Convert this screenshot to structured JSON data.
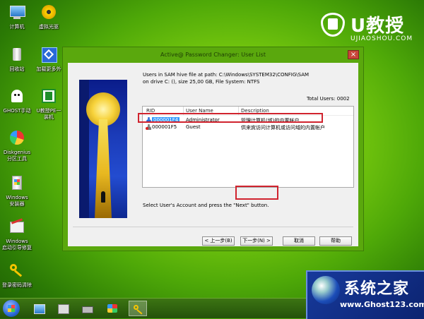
{
  "desktop": {
    "icons": [
      {
        "label": "计算机",
        "icon": "computer-icon"
      },
      {
        "label": "虚拟光驱",
        "icon": "virtual-drive-icon"
      },
      {
        "label": "回收站",
        "icon": "recycle-bin-icon"
      },
      {
        "label": "加载更多外",
        "icon": "load-more-icon"
      },
      {
        "label": "GHOST手动",
        "icon": "ghost-icon"
      },
      {
        "label": "U教授PE一",
        "label2": "装机",
        "icon": "pe-install-icon"
      },
      {
        "label": "Diskgenius",
        "label2": "分区工具",
        "icon": "diskgenius-icon"
      },
      {
        "label": "Windows",
        "label2": "安装器",
        "icon": "windows-installer-icon"
      },
      {
        "label": "Windows",
        "label2": "启动引导修复",
        "icon": "boot-repair-icon"
      },
      {
        "label": "登录密码清除",
        "icon": "password-clear-icon"
      }
    ]
  },
  "brand": {
    "title": "U教授",
    "subtitle": "UJIAOSHOU.COM"
  },
  "window": {
    "title": "Active@ Password Changer: User List",
    "close_label": "×",
    "info_line1": "Users in SAM hive file at path: C:\\Windows\\SYSTEM32\\CONFIG\\SAM",
    "info_line2": "on drive C: (), size 25,00 GB, File System: NTFS",
    "total_users": "Total Users: 0002",
    "table": {
      "headers": [
        "RID",
        "User Name",
        "Description"
      ],
      "rows": [
        {
          "rid": "000001F4",
          "name": "Administrator",
          "description": "管理计算机(域)的内置帐户"
        },
        {
          "rid": "000001F5",
          "name": "Guest",
          "description": "供来宾访问计算机或访问域的内置帐户"
        }
      ]
    },
    "hint": "Select User's Account and press the \"Next\" button.",
    "buttons": {
      "back": "< 上一步(B)",
      "next": "下一步(N) >",
      "cancel": "取消",
      "help": "帮助"
    }
  },
  "watermark": {
    "title": "系统之家",
    "url": "www.Ghost123.com"
  },
  "colors": {
    "highlight": "#d0232e",
    "selection": "#3399ff"
  }
}
